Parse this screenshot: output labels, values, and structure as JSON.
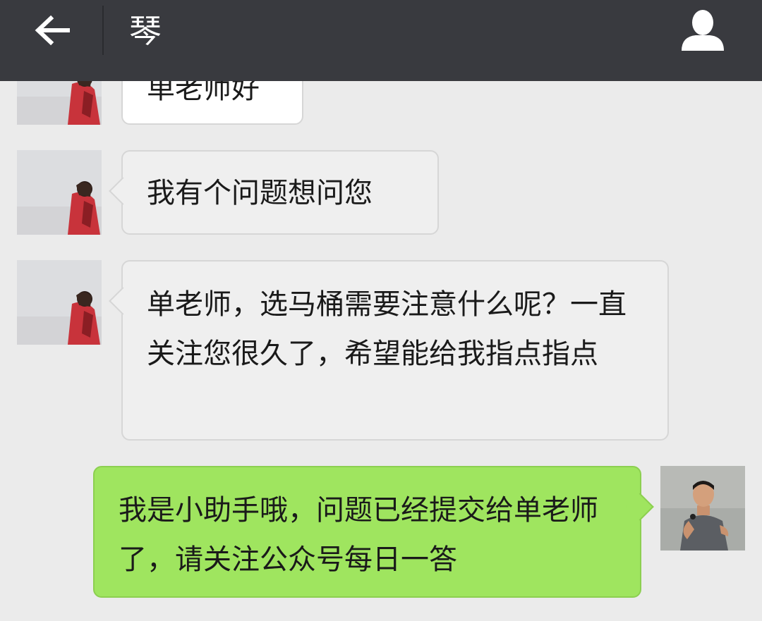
{
  "header": {
    "title": "琴",
    "back_icon": "arrow-left-icon",
    "profile_icon": "person-icon"
  },
  "messages": [
    {
      "sender": "contact",
      "text": "单老师好"
    },
    {
      "sender": "contact",
      "text": "我有个问题想问您"
    },
    {
      "sender": "contact",
      "text": "单老师，选马桶需要注意什么呢？一直关注您很久了，希望能给我指点指点"
    },
    {
      "sender": "self",
      "text": "我是小助手哦，问题已经提交给单老师了，请关注公众号每日一答"
    }
  ],
  "colors": {
    "topbar": "#393a3f",
    "background": "#ebebeb",
    "incoming_bubble": "#efefef",
    "outgoing_bubble": "#9fe55f"
  }
}
